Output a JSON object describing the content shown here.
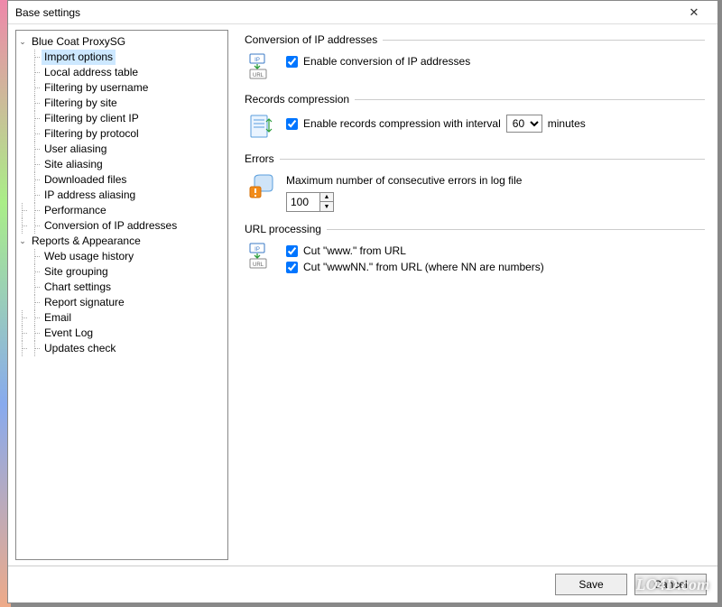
{
  "window": {
    "title": "Base settings"
  },
  "tree": [
    {
      "label": "Blue Coat ProxySG",
      "depth": 0,
      "expanded": true,
      "children": [
        {
          "label": "Import options",
          "depth": 1,
          "selected": true
        },
        {
          "label": "Local address table",
          "depth": 1
        },
        {
          "label": "Filtering by username",
          "depth": 1
        },
        {
          "label": "Filtering by site",
          "depth": 1
        },
        {
          "label": "Filtering by client IP",
          "depth": 1
        },
        {
          "label": "Filtering by protocol",
          "depth": 1
        },
        {
          "label": "User aliasing",
          "depth": 1
        },
        {
          "label": "Site aliasing",
          "depth": 1
        },
        {
          "label": "Downloaded files",
          "depth": 1
        },
        {
          "label": "IP address aliasing",
          "depth": 1
        }
      ]
    },
    {
      "label": "Performance",
      "depth": 0,
      "leaf": true
    },
    {
      "label": "Conversion of IP addresses",
      "depth": 0,
      "leaf": true
    },
    {
      "label": "Reports & Appearance",
      "depth": 0,
      "expanded": true,
      "children": [
        {
          "label": "Web usage history",
          "depth": 1
        },
        {
          "label": "Site grouping",
          "depth": 1
        },
        {
          "label": "Chart settings",
          "depth": 1
        },
        {
          "label": "Report signature",
          "depth": 1
        }
      ]
    },
    {
      "label": "Email",
      "depth": 0,
      "leaf": true
    },
    {
      "label": "Event Log",
      "depth": 0,
      "leaf": true
    },
    {
      "label": "Updates check",
      "depth": 0,
      "leaf": true
    }
  ],
  "sections": {
    "ip": {
      "title": "Conversion of IP addresses",
      "checkbox": {
        "label": "Enable conversion of IP addresses",
        "checked": true
      }
    },
    "records": {
      "title": "Records compression",
      "checkbox": {
        "label": "Enable records compression with interval",
        "checked": true
      },
      "interval_value": "60",
      "interval_unit": "minutes"
    },
    "errors": {
      "title": "Errors",
      "label": "Maximum number of consecutive errors in log file",
      "value": "100"
    },
    "url": {
      "title": "URL processing",
      "cut_www": {
        "label": "Cut \"www.\" from URL",
        "checked": true
      },
      "cut_wwwnn": {
        "label": "Cut \"wwwNN.\" from URL (where NN are numbers)",
        "checked": true
      }
    }
  },
  "buttons": {
    "save": "Save",
    "cancel": "Cancel"
  },
  "watermark": "LO4D.com"
}
